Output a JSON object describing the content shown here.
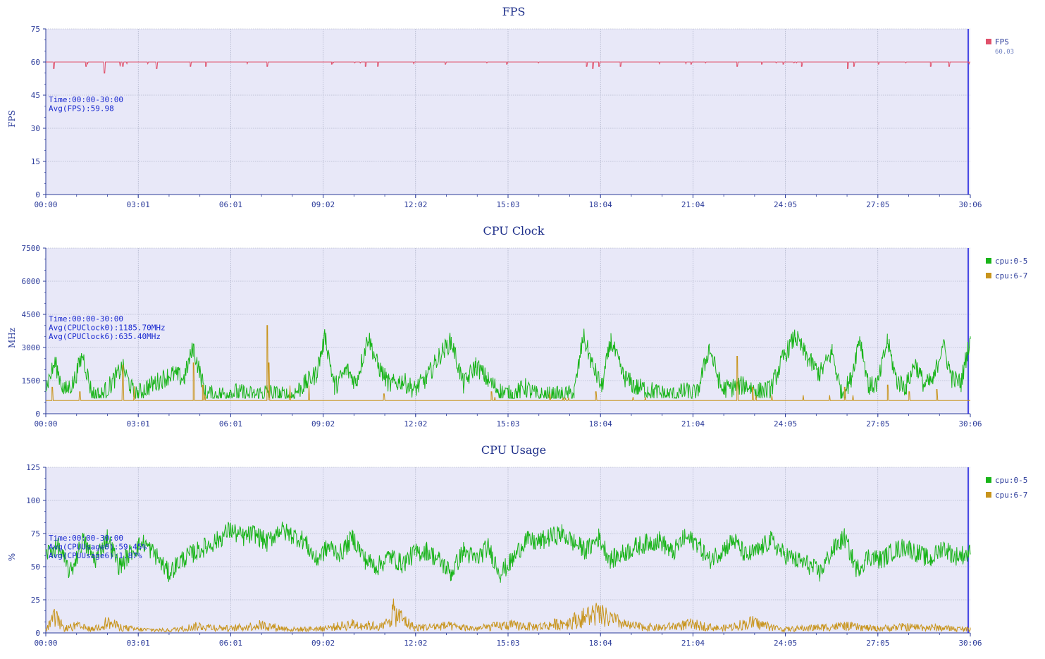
{
  "chart_data": [
    {
      "type": "line",
      "title": "FPS",
      "ylabel": "FPS",
      "ylim": [
        0,
        75
      ],
      "yticks": [
        "0",
        "15",
        "30",
        "45",
        "60",
        "75"
      ],
      "xticks": [
        "00:00",
        "03:01",
        "06:01",
        "09:02",
        "12:02",
        "15:03",
        "18:04",
        "21:04",
        "24:05",
        "27:05",
        "30:06"
      ],
      "xlim_minutes": [
        0,
        30.1
      ],
      "grid": true,
      "legend_position": "right",
      "annotations": [
        "Time:00:00-30:00",
        "Avg(FPS):59.98"
      ],
      "series": [
        {
          "name": "FPS",
          "legend_value": "60.03",
          "color": "#e0506a",
          "baseline": 60,
          "x": [
            0,
            0.25,
            1.3,
            1.9,
            2.5,
            3.6,
            4.7,
            5.2,
            7.2,
            9.3,
            10.4,
            10.8,
            13.0,
            15.0,
            17.6,
            17.8,
            18.0,
            18.7,
            21.0,
            22.5,
            23.3,
            24.0,
            24.6,
            26.1,
            26.3,
            27.1,
            28.8,
            29.4,
            30.1
          ],
          "values": [
            60,
            57,
            58,
            55,
            58,
            57,
            58,
            58,
            58,
            59,
            58,
            58,
            59,
            59,
            58,
            57,
            58,
            58,
            59,
            58,
            59,
            59,
            58,
            57,
            58,
            59,
            58,
            58,
            60
          ]
        }
      ]
    },
    {
      "type": "line",
      "title": "CPU Clock",
      "ylabel": "MHz",
      "ylim": [
        0,
        7500
      ],
      "yticks": [
        "0",
        "1500",
        "3000",
        "4500",
        "6000",
        "7500"
      ],
      "xticks": [
        "00:00",
        "03:01",
        "06:01",
        "09:02",
        "12:02",
        "15:03",
        "18:04",
        "21:04",
        "24:05",
        "27:05",
        "30:06"
      ],
      "xlim_minutes": [
        0,
        30.1
      ],
      "grid": true,
      "legend_position": "right",
      "annotations": [
        "Time:00:00-30:00",
        "Avg(CPUClock0):1185.70MHz",
        "Avg(CPUClock6):635.40MHz"
      ],
      "series": [
        {
          "name": "cpu:0-5",
          "color": "#18b418",
          "x": [
            0,
            0.3,
            0.6,
            0.9,
            1.2,
            1.5,
            1.8,
            2.1,
            2.5,
            2.9,
            3.3,
            3.7,
            4.1,
            4.5,
            4.8,
            5.2,
            5.6,
            6.0,
            6.4,
            6.8,
            7.2,
            7.6,
            8.0,
            8.4,
            8.8,
            9.1,
            9.4,
            9.8,
            10.1,
            10.5,
            10.8,
            11.2,
            11.6,
            12.0,
            12.4,
            12.8,
            13.2,
            13.6,
            14.0,
            14.4,
            14.8,
            15.2,
            15.6,
            16.0,
            16.4,
            16.8,
            17.2,
            17.5,
            17.8,
            18.1,
            18.4,
            18.8,
            19.2,
            19.6,
            20.0,
            20.4,
            20.8,
            21.2,
            21.6,
            22.0,
            22.4,
            22.8,
            23.2,
            23.6,
            24.0,
            24.4,
            24.8,
            25.2,
            25.6,
            25.9,
            26.2,
            26.5,
            26.8,
            27.1,
            27.4,
            27.7,
            28.0,
            28.3,
            28.6,
            28.9,
            29.2,
            29.5,
            29.8,
            30.1
          ],
          "values": [
            1200,
            2300,
            1000,
            1400,
            2700,
            900,
            800,
            1300,
            2100,
            800,
            1200,
            1500,
            1800,
            1600,
            3000,
            900,
            800,
            1000,
            900,
            800,
            1000,
            800,
            800,
            1300,
            1800,
            3500,
            1200,
            2000,
            1400,
            3500,
            2200,
            1300,
            1500,
            1100,
            1600,
            2600,
            3300,
            1300,
            2200,
            1500,
            1000,
            800,
            1200,
            800,
            800,
            800,
            900,
            3500,
            2200,
            1200,
            3300,
            1700,
            1200,
            1100,
            900,
            800,
            1000,
            900,
            3000,
            1100,
            1200,
            1300,
            1000,
            1100,
            2500,
            3500,
            2500,
            1800,
            2800,
            900,
            1500,
            3500,
            1200,
            1400,
            3300,
            1500,
            1200,
            2300,
            1300,
            1500,
            3200,
            1600,
            1400,
            3500
          ]
        },
        {
          "name": "cpu:6-7",
          "color": "#c8941c",
          "baseline": 600,
          "x": [
            0,
            0.2,
            1.1,
            2.5,
            4.8,
            5.1,
            7.2,
            7.25,
            11.0,
            14.5,
            16.4,
            17.9,
            22.5,
            23.0,
            26.0,
            27.4,
            28.1,
            29.0,
            30.1
          ],
          "values": [
            600,
            1200,
            1000,
            2200,
            2300,
            1300,
            4000,
            2300,
            900,
            1000,
            900,
            1000,
            2600,
            1200,
            1200,
            1300,
            1000,
            1100,
            600
          ]
        }
      ]
    },
    {
      "type": "line",
      "title": "CPU Usage",
      "ylabel": "%",
      "ylim": [
        0,
        125
      ],
      "yticks": [
        "0",
        "25",
        "50",
        "75",
        "100",
        "125"
      ],
      "xticks": [
        "00:00",
        "03:01",
        "06:01",
        "09:02",
        "12:02",
        "15:03",
        "18:04",
        "21:04",
        "24:05",
        "27:05",
        "30:06"
      ],
      "xlim_minutes": [
        0,
        30.1
      ],
      "grid": true,
      "legend_position": "right",
      "annotations": [
        "Time:00:00-30:00",
        "Avg(CPUUsage0):59.45%",
        "Avg(CPUUsage6):1.87%"
      ],
      "series": [
        {
          "name": "cpu:0-5",
          "color": "#18b418",
          "x": [
            0,
            0.4,
            0.8,
            1.2,
            1.6,
            2.0,
            2.4,
            2.8,
            3.2,
            3.6,
            4.0,
            4.4,
            4.8,
            5.2,
            5.6,
            6.0,
            6.4,
            6.8,
            7.2,
            7.6,
            8.0,
            8.4,
            8.8,
            9.2,
            9.6,
            10.0,
            10.4,
            10.8,
            11.2,
            11.6,
            12.0,
            12.4,
            12.8,
            13.2,
            13.6,
            14.0,
            14.4,
            14.8,
            15.2,
            15.6,
            16.0,
            16.4,
            16.8,
            17.2,
            17.6,
            18.0,
            18.4,
            18.8,
            19.2,
            19.6,
            20.0,
            20.4,
            20.8,
            21.2,
            21.6,
            22.0,
            22.4,
            22.8,
            23.2,
            23.6,
            24.0,
            24.4,
            24.8,
            25.2,
            25.6,
            26.0,
            26.4,
            26.8,
            27.2,
            27.6,
            28.0,
            28.4,
            28.8,
            29.2,
            29.6,
            30.1
          ],
          "values": [
            60,
            65,
            45,
            70,
            55,
            72,
            50,
            62,
            68,
            58,
            45,
            55,
            60,
            65,
            70,
            78,
            72,
            75,
            68,
            78,
            74,
            70,
            55,
            65,
            60,
            72,
            55,
            50,
            58,
            52,
            60,
            62,
            55,
            45,
            62,
            55,
            65,
            45,
            55,
            70,
            68,
            72,
            75,
            68,
            62,
            72,
            55,
            60,
            65,
            68,
            70,
            60,
            72,
            68,
            55,
            62,
            70,
            58,
            62,
            70,
            60,
            55,
            52,
            45,
            62,
            72,
            48,
            58,
            55,
            62,
            65,
            60,
            55,
            65,
            58,
            60
          ]
        },
        {
          "name": "cpu:6-7",
          "color": "#c8941c",
          "x": [
            0,
            0.3,
            0.6,
            1.0,
            1.5,
            2.0,
            2.5,
            3.0,
            4.0,
            5.0,
            6.0,
            7.0,
            8.0,
            9.0,
            10.0,
            11.0,
            11.3,
            12.0,
            13.0,
            14.0,
            15.0,
            16.0,
            17.0,
            17.9,
            19.0,
            20.0,
            21.0,
            22.0,
            23.0,
            24.0,
            25.0,
            26.0,
            27.0,
            28.0,
            29.0,
            30.1
          ],
          "values": [
            3,
            18,
            5,
            8,
            4,
            12,
            6,
            4,
            3,
            8,
            5,
            9,
            4,
            5,
            10,
            7,
            24,
            6,
            8,
            5,
            9,
            7,
            12,
            22,
            8,
            6,
            10,
            5,
            12,
            4,
            6,
            8,
            5,
            7,
            6,
            4
          ]
        }
      ]
    }
  ]
}
